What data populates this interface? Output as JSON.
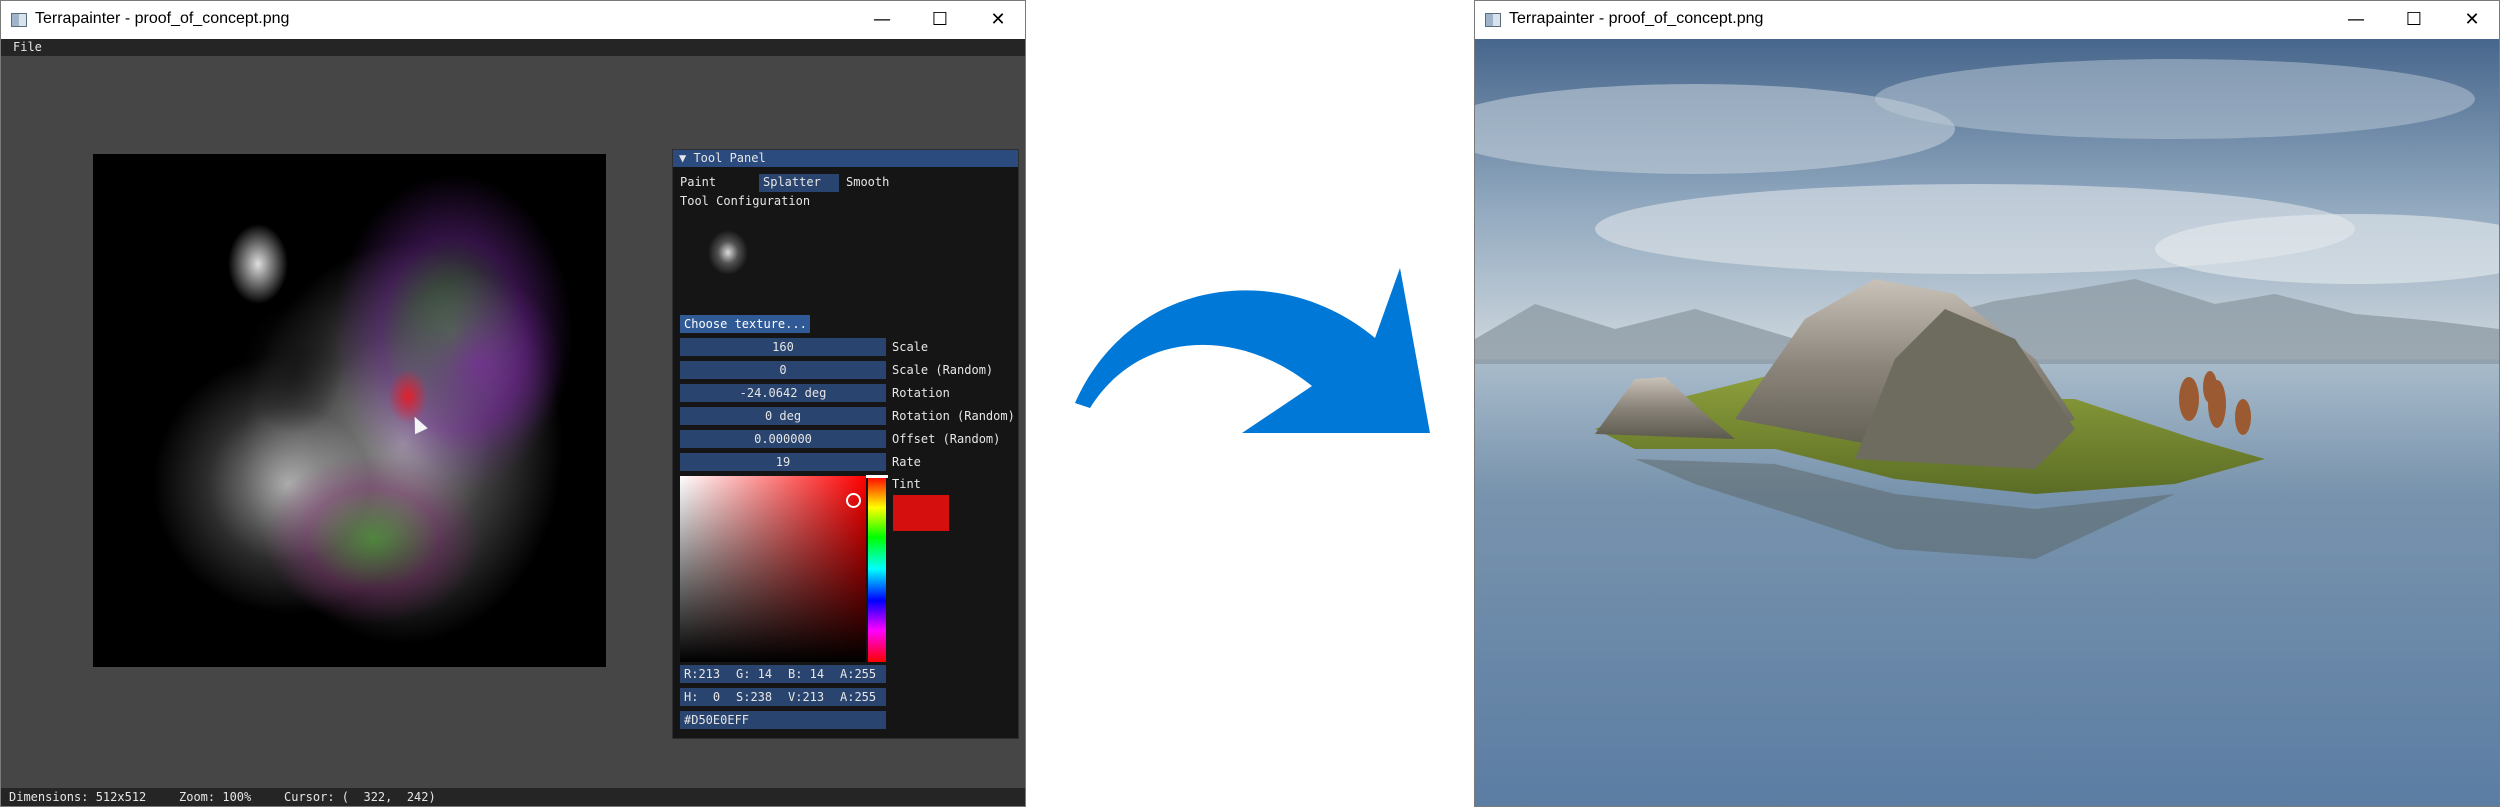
{
  "left_window": {
    "title": "Terrapainter - proof_of_concept.png",
    "controls": {
      "minimize": "—",
      "maximize": "☐",
      "close": "✕"
    },
    "menu": {
      "file": "File"
    },
    "status": {
      "dimensions": "Dimensions: 512x512",
      "zoom": "Zoom: 100%",
      "cursor": "Cursor: (  322,  242)"
    },
    "tool_panel": {
      "header": "▼ Tool Panel",
      "tabs": [
        "Paint",
        "Splatter",
        "Smooth"
      ],
      "active_tab": "Splatter",
      "config_heading": "Tool Configuration",
      "choose_texture": "Choose texture...",
      "params": [
        {
          "value": "160",
          "label": "Scale"
        },
        {
          "value": "0",
          "label": "Scale (Random)"
        },
        {
          "value": "-24.0642 deg",
          "label": "Rotation"
        },
        {
          "value": "0 deg",
          "label": "Rotation (Random)"
        },
        {
          "value": "0.000000",
          "label": "Offset (Random)"
        },
        {
          "value": "19",
          "label": "Rate"
        }
      ],
      "tint_label": "Tint",
      "tint_color": "#D50E0E",
      "rgba": {
        "r": "R:213",
        "g": "G: 14",
        "b": "B: 14",
        "a": "A:255"
      },
      "hsva": {
        "h": "H:  0",
        "s": "S:238",
        "v": "V:213",
        "a": "A:255"
      },
      "hex": "#D50E0EFF"
    }
  },
  "right_window": {
    "title": "Terrapainter - proof_of_concept.png",
    "controls": {
      "minimize": "—",
      "maximize": "☐",
      "close": "✕"
    }
  },
  "colors": {
    "arrow": "#0078D7",
    "panel_header": "#2b4a7e",
    "field": "#29446e",
    "button": "#2f5a96"
  }
}
